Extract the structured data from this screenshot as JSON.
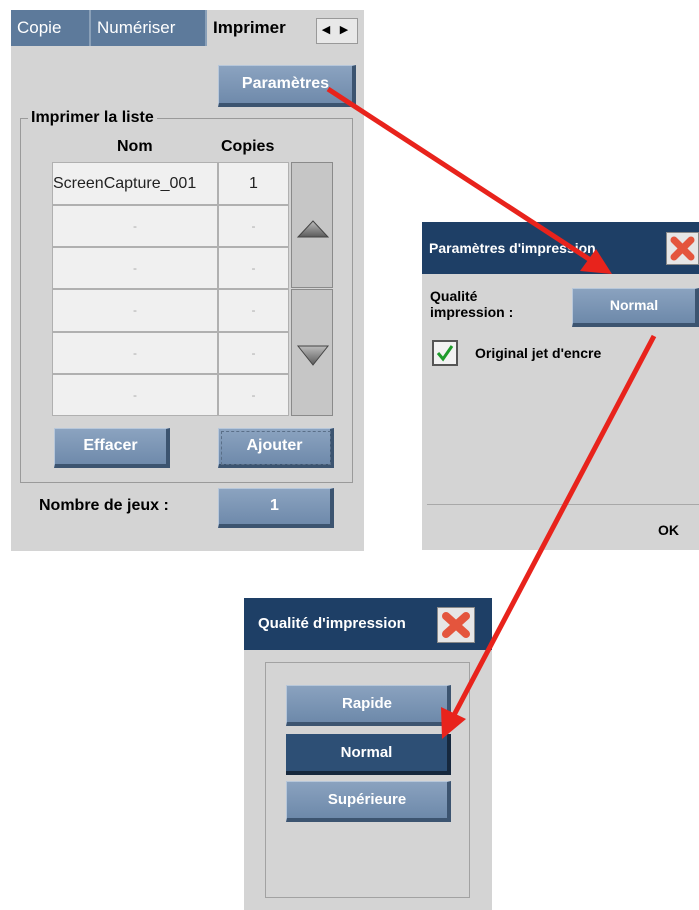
{
  "print_panel": {
    "tabs": [
      "Copie",
      "Numériser",
      "Imprimer"
    ],
    "active_tab": "Imprimer",
    "tab_scroll_left": "◀",
    "tab_scroll_right": "▶",
    "settings_button": "Paramètres",
    "list_group_label": "Imprimer la liste",
    "columns": {
      "name": "Nom",
      "copies": "Copies"
    },
    "rows": [
      {
        "name": "ScreenCapture_001",
        "copies": "1"
      },
      {
        "name": "-",
        "copies": "-"
      },
      {
        "name": "-",
        "copies": "-"
      },
      {
        "name": "-",
        "copies": "-"
      },
      {
        "name": "-",
        "copies": "-"
      },
      {
        "name": "-",
        "copies": "-"
      }
    ],
    "clear_button": "Effacer",
    "add_button": "Ajouter",
    "sets_label": "Nombre de jeux :",
    "sets_value": "1"
  },
  "print_settings_dialog": {
    "title": "Paramètres d'impression",
    "quality_label_line1": "Qualité",
    "quality_label_line2": "impression :",
    "quality_value": "Normal",
    "inkjet_label": "Original jet d'encre",
    "inkjet_checked": true,
    "ok_button": "OK"
  },
  "print_quality_dialog": {
    "title": "Qualité d'impression",
    "options": [
      "Rapide",
      "Normal",
      "Supérieure"
    ],
    "selected": "Normal"
  },
  "colors": {
    "title_bar": "#1e3f66",
    "button": "#7390b1",
    "selected_button": "#2d4f75",
    "arrow": "#e8231c",
    "panel": "#d4d4d4"
  }
}
